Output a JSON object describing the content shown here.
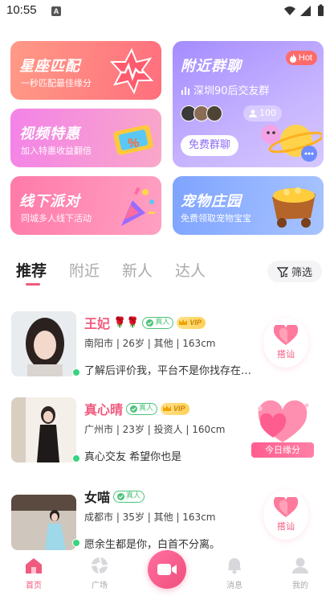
{
  "status_bar": {
    "time": "10:55",
    "notif_icon": "A"
  },
  "cards": {
    "star_match": {
      "title": "星座匹配",
      "subtitle": "一秒匹配最佳缘分"
    },
    "video_deal": {
      "title": "视频特惠",
      "subtitle": "加入特惠收益翻倍"
    },
    "offline_party": {
      "title": "线下派对",
      "subtitle": "同城多人线下活动"
    },
    "nearby_group": {
      "title": "附近群聊",
      "hot_label": "Hot",
      "group_name": "深圳90后交友群",
      "member_count": "100",
      "join_button": "免费群聊"
    },
    "pet_manor": {
      "title": "宠物庄园",
      "subtitle": "免费领取宠物宝宝"
    }
  },
  "tabs": [
    "推荐",
    "附近",
    "新人",
    "达人"
  ],
  "active_tab": "推荐",
  "filter_label": "筛选",
  "users": [
    {
      "name": "王妃",
      "name_color": "pink",
      "roses": "🌹🌹",
      "real_label": "真人",
      "vip_label": "VIP",
      "info": "南阳市 | 26岁 | 其他 | 163cm",
      "bio": "了解后评价我，平台不是你找存在…",
      "action_label": "搭讪"
    },
    {
      "name": "真心晴",
      "name_color": "pink",
      "real_label": "真人",
      "vip_label": "VIP",
      "info": "广州市 | 23岁 | 投资人 | 160cm",
      "bio": "真心交友 希望你也是",
      "action_label": "今日缘分"
    },
    {
      "name": "女喵",
      "name_color": "dark",
      "real_label": "真人",
      "info": "成都市 | 35岁 | 其他 | 163cm",
      "bio": "愿余生都是你，白首不分离。",
      "action_label": "搭讪"
    }
  ],
  "bottom_nav": {
    "home": "首页",
    "plaza": "广场",
    "messages": "消息",
    "mine": "我的"
  },
  "colors": {
    "accent": "#f05a7e",
    "online": "#37d47f",
    "real_badge": "#4cc37a"
  }
}
